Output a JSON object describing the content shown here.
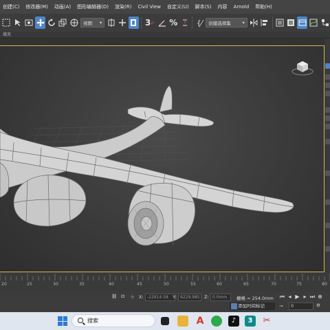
{
  "menu": {
    "items": [
      "创建(C)",
      "修改器(M)",
      "动画(A)",
      "图形编辑器(D)",
      "渲染(R)",
      "Civil View",
      "自定义(U)",
      "脚本(S)",
      "内容",
      "Arnold",
      "帮助(H)"
    ]
  },
  "toolbar": {
    "view_dropdown": "视图",
    "selection_set_placeholder": "创建选择集",
    "snap_label": "3"
  },
  "subbar": {
    "label": "填充"
  },
  "timeline": {
    "labels": [
      "20",
      "25",
      "30",
      "35",
      "40",
      "45",
      "50",
      "55",
      "60",
      "65",
      "70",
      "75",
      "80"
    ]
  },
  "status": {
    "x_label": "X:",
    "x_value": "-22914.58",
    "y_label": "Y:",
    "y_value": "9229.985",
    "z_label": "Z:",
    "z_value": "0.0mm",
    "grid_label": "栅格 = 254.0mm",
    "add_time_tag": "添加时间标记",
    "frame_value": "0"
  },
  "taskbar": {
    "search_placeholder": "搜索"
  },
  "colors": {
    "viewport_border": "#d4b84a",
    "accent_blue": "#4f86c6",
    "model_fill": "#c9c9c9"
  }
}
